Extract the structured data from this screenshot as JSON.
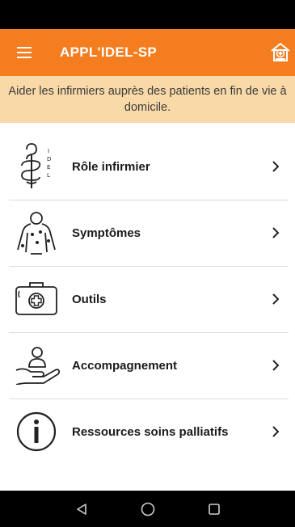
{
  "app_bar": {
    "title": "APPL'IDEL-SP",
    "menu_icon": "hamburger-menu-icon",
    "home_icon": "house-medical-icon",
    "color": "#f47d20"
  },
  "banner": {
    "text": "Aider les infirmiers auprès des patients en fin de vie à domicile.",
    "color": "#fad9a9"
  },
  "menu": {
    "items": [
      {
        "label": "Rôle infirmier",
        "icon": "caduceus-idel-icon"
      },
      {
        "label": "Symptômes",
        "icon": "body-pain-icon"
      },
      {
        "label": "Outils",
        "icon": "medical-kit-icon"
      },
      {
        "label": "Accompagnement",
        "icon": "hand-holding-person-icon"
      },
      {
        "label": "Ressources soins palliatifs",
        "icon": "info-circle-icon"
      }
    ]
  },
  "nav_bar": {
    "back_icon": "triangle-back-icon",
    "home_icon": "circle-home-icon",
    "recents_icon": "square-recents-icon"
  }
}
